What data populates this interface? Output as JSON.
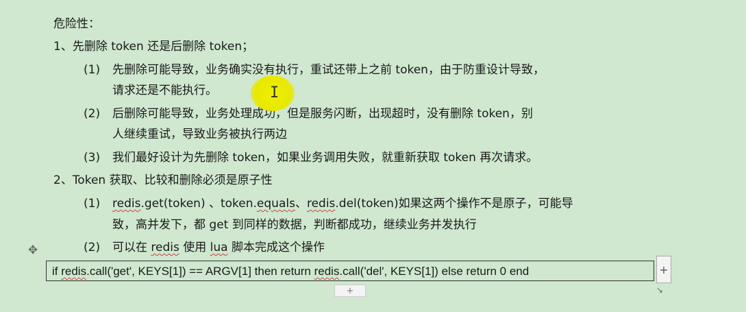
{
  "doc": {
    "heading": "危险性：",
    "item1": "1、先删除 token 还是后删除 token；",
    "s1_1_num": "(1)",
    "s1_1_a": "先删除可能导致，业务确实没有执行，重试还带上之前 token，由于防重设计导致，",
    "s1_1_b": "请求还是不能执行。",
    "s1_2_num": "(2)",
    "s1_2_a": "后删除可能导致，业务处理成功，但是服务闪断，出现超时，没有删除 token，别",
    "s1_2_b": "人继续重试，导致业务被执行两边",
    "s1_3_num": "(3)",
    "s1_3_a": "我们最好设计为先删除 token，如果业务调用失败，就重新获取 token 再次请求。",
    "item2": "2、Token 获取、比较和删除必须是原子性",
    "s2_1_num": "(1)",
    "s2_1_p1": "redis",
    "s2_1_p2": ".get(token) 、token.",
    "s2_1_p3": "equals",
    "s2_1_p4": "、",
    "s2_1_p5": "redis",
    "s2_1_p6": ".del(token)如果这两个操作不是原子，可能导",
    "s2_1_b": "致，高并发下，都 get 到同样的数据，判断都成功，继续业务并发执行",
    "s2_2_num": "(2)",
    "s2_2_a1": "可以在 ",
    "s2_2_a2": "redis",
    "s2_2_a3": " 使用 ",
    "s2_2_a4": "lua",
    "s2_2_a5": " 脚本完成这个操作"
  },
  "code": {
    "c1": "if ",
    "c2": "redis",
    "c3": ".call('get', KEYS[1]) == ARGV[1] then return ",
    "c4": "redis",
    "c5": ".call('del', KEYS[1]) else return 0 end"
  },
  "controls": {
    "add_column": "+",
    "add_row": "+",
    "move_handle": "✥",
    "resize_handle": "↘"
  }
}
